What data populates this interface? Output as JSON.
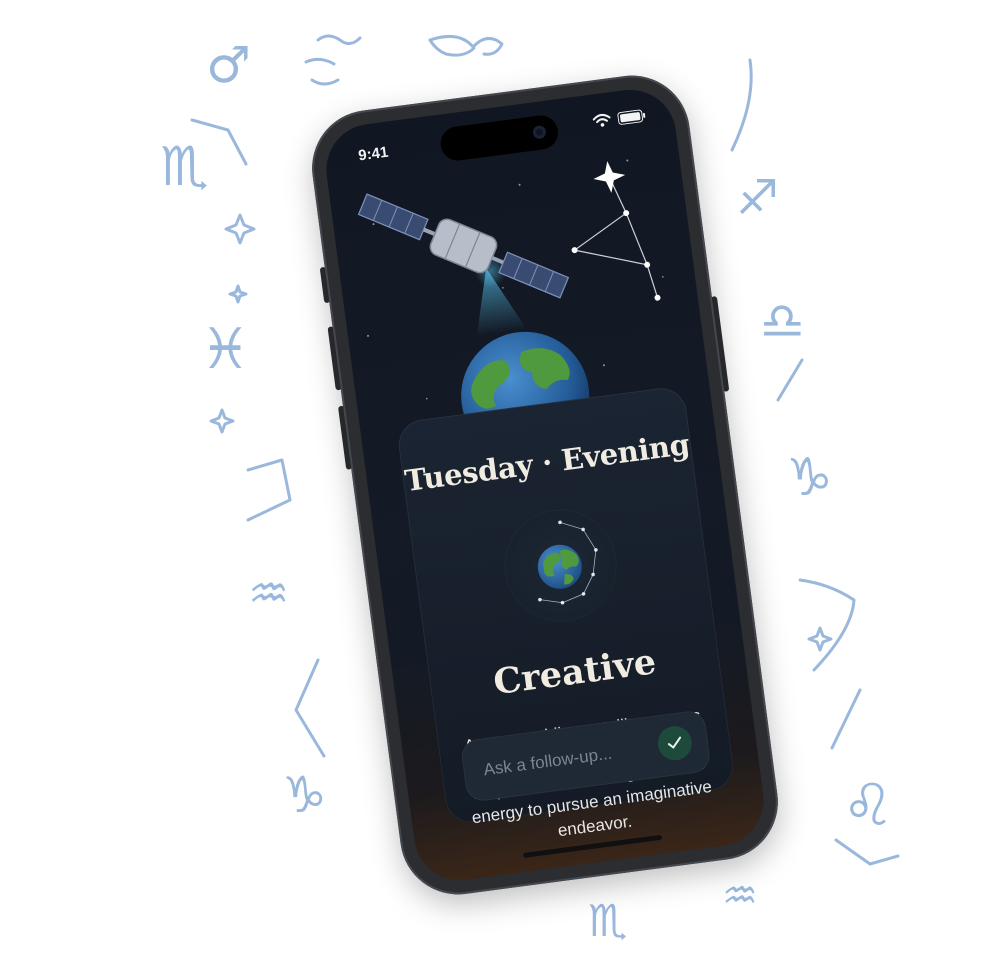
{
  "status_bar": {
    "time": "9:41",
    "icons": [
      "wifi-icon",
      "battery-icon"
    ]
  },
  "hero": {
    "icons": [
      "satellite-icon",
      "earth-icon",
      "constellation-icon"
    ]
  },
  "card": {
    "title": "Tuesday · Evening",
    "badge_icon": "earth-orbit-icon",
    "mood": "Creative",
    "description": "As your guiding satallite passes near Aries, your cretivity will be amplitied this evening. Use tnis energy to pursue an imaginative endeavor."
  },
  "followup": {
    "placeholder": "Ask a follow-up...",
    "send_icon": "checkmark-icon"
  },
  "background": {
    "glyphs": [
      "♂",
      "♏",
      "♓",
      "♒",
      "♑",
      "♐",
      "♎",
      "♑",
      "♌",
      "♏",
      "♒"
    ]
  },
  "colors": {
    "doodle": "#9ab8dc",
    "screen_bg": "#121822",
    "text": "#f1ece1",
    "send_button": "#1d4a3a",
    "accent_glow": "#5fd0ff"
  }
}
